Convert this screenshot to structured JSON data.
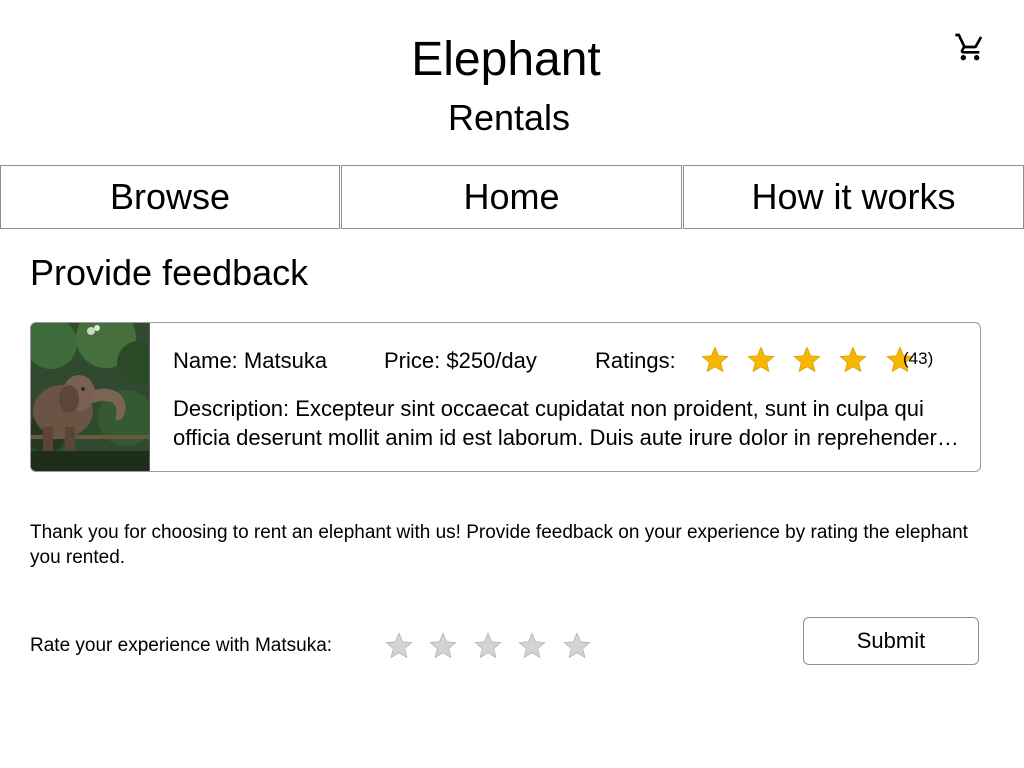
{
  "header": {
    "title": "Elephant",
    "subtitle": "Rentals",
    "cart_icon": "cart-icon"
  },
  "nav": {
    "tabs": [
      {
        "label": "Browse"
      },
      {
        "label": "Home"
      },
      {
        "label": "How it works"
      }
    ]
  },
  "main": {
    "section_title": "Provide feedback",
    "listing": {
      "image": "elephant-photo",
      "name": "Name: Matsuka",
      "price": "Price: $250/day",
      "ratings_label": "Ratings:",
      "rating_value": 5,
      "rating_max": 5,
      "rating_count": "(43)",
      "star_color": "#f5b800",
      "description": "Description: Excepteur sint occaecat cupidatat non proident, sunt in culpa qui officia deserunt mollit anim id est laborum. Duis aute irure dolor in reprehenderit in voluptate velit esse cillum dolore eu fugiat nulla pariatur."
    },
    "thanks_text": "Thank you for choosing to rent an elephant with us! Provide feedback on your experience by rating the elephant you rented.",
    "rate": {
      "label": "Rate your experience with Matsuka:",
      "value": 0,
      "max": 5,
      "empty_star_color": "#d3d3d3"
    },
    "submit_label": "Submit"
  }
}
